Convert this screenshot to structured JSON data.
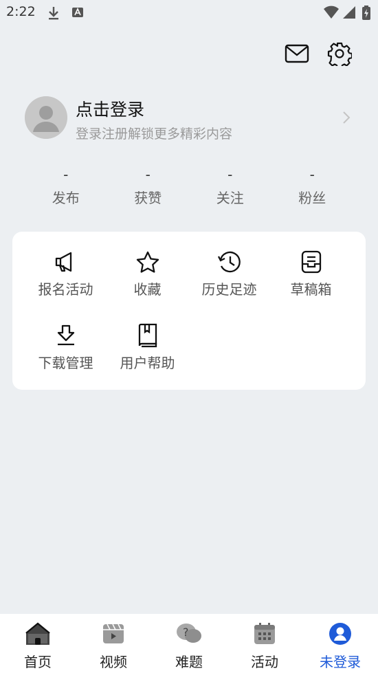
{
  "status_bar": {
    "time": "2:22"
  },
  "profile": {
    "title": "点击登录",
    "subtitle": "登录注册解锁更多精彩内容"
  },
  "stats": [
    {
      "value": "-",
      "label": "发布"
    },
    {
      "value": "-",
      "label": "获赞"
    },
    {
      "value": "-",
      "label": "关注"
    },
    {
      "value": "-",
      "label": "粉丝"
    }
  ],
  "grid": [
    {
      "label": "报名活动",
      "icon": "megaphone-icon"
    },
    {
      "label": "收藏",
      "icon": "star-icon"
    },
    {
      "label": "历史足迹",
      "icon": "history-icon"
    },
    {
      "label": "草稿箱",
      "icon": "drafts-icon"
    },
    {
      "label": "下载管理",
      "icon": "download-icon"
    },
    {
      "label": "用户帮助",
      "icon": "book-icon"
    }
  ],
  "bottom_nav": [
    {
      "label": "首页",
      "icon": "home-icon"
    },
    {
      "label": "视频",
      "icon": "video-icon"
    },
    {
      "label": "难题",
      "icon": "question-icon"
    },
    {
      "label": "活动",
      "icon": "calendar-icon"
    },
    {
      "label": "未登录",
      "icon": "user-icon",
      "active": true
    }
  ],
  "colors": {
    "accent": "#1f5bd8",
    "background": "#eceff2"
  }
}
